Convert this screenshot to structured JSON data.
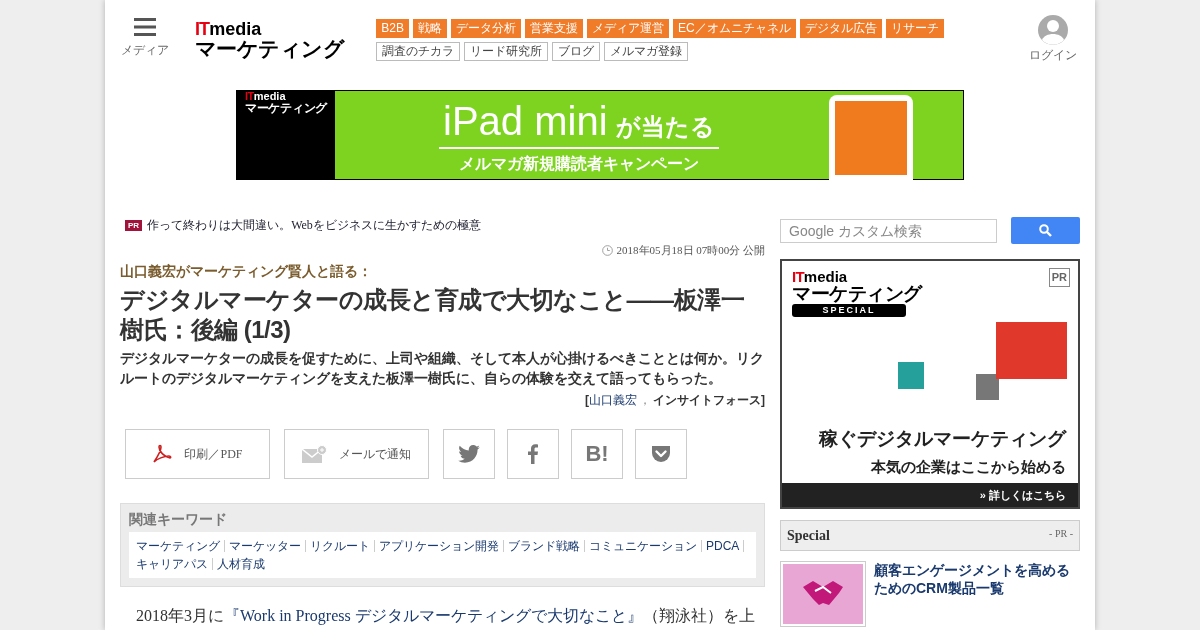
{
  "header": {
    "menu_label": "メディア",
    "logo": {
      "prefix": "IT",
      "suffix": "media",
      "name": "マーケティング"
    },
    "categories": [
      "B2B",
      "戦略",
      "データ分析",
      "営業支援",
      "メディア運営",
      "EC／オムニチャネル",
      "デジタル広告",
      "リサーチ"
    ],
    "sub_links": [
      "調査のチカラ",
      "リード研究所",
      "ブログ",
      "メルマガ登録"
    ],
    "login": "ログイン"
  },
  "banner": {
    "logo": {
      "prefix": "IT",
      "suffix": "media",
      "name": "マーケティング"
    },
    "headline": "iPad mini",
    "headline_suffix": "が当たる",
    "subline": "メルマガ新規購読者キャンペーン"
  },
  "article": {
    "pr": {
      "badge": "PR",
      "text": "作って終わりは大間違い。Webをビジネスに生かすための極意"
    },
    "date": "2018年05月18日 07時00分 公開",
    "series": "山口義宏がマーケティング賢人と語る：",
    "title": "デジタルマーケターの成長と育成で大切なこと――板澤一樹氏：後編 (1/3)",
    "lead": "デジタルマーケターの成長を促すために、上司や組織、そして本人が心掛けるべきこととは何か。リクルートのデジタルマーケティングを支えた板澤一樹氏に、自らの体験を交えて語ってもらった。",
    "byline": {
      "open": "[",
      "author": "山口義宏",
      "separator": "，",
      "org": "インサイトフォース",
      "close": "]"
    },
    "share": [
      {
        "kind": "pdf",
        "label": "印刷／PDF"
      },
      {
        "kind": "mail",
        "label": "メールで通知"
      },
      {
        "kind": "twitter"
      },
      {
        "kind": "facebook"
      },
      {
        "kind": "hatena",
        "label": "B!"
      },
      {
        "kind": "pocket"
      }
    ],
    "keywords": {
      "heading": "関連キーワード",
      "items": [
        "マーケティング",
        "マーケッター",
        "リクルート",
        "アプリケーション開発",
        "ブランド戦略",
        "コミュニケーション",
        "PDCA",
        "キャリアパス",
        "人材育成"
      ]
    },
    "body": {
      "before": "2018年3月に",
      "link": "『Work in Progress デジタルマーケティングで大切なこと』",
      "after": "（翔泳社）を上"
    }
  },
  "sidebar": {
    "search": {
      "placeholder": "Google カスタム検索"
    },
    "ad": {
      "logo": {
        "prefix": "IT",
        "suffix": "media",
        "name": "マーケティング"
      },
      "tag": "SPECIAL",
      "pr": "PR",
      "headline": "稼ぐデジタルマーケティング",
      "subline": "本気の企業はここから始める",
      "cta": "» 詳しくはこちら"
    },
    "special": {
      "heading": "Special",
      "pr": "- PR -",
      "items": [
        {
          "title": "顧客エンゲージメントを高めるためのCRM製品一覧"
        }
      ]
    }
  }
}
